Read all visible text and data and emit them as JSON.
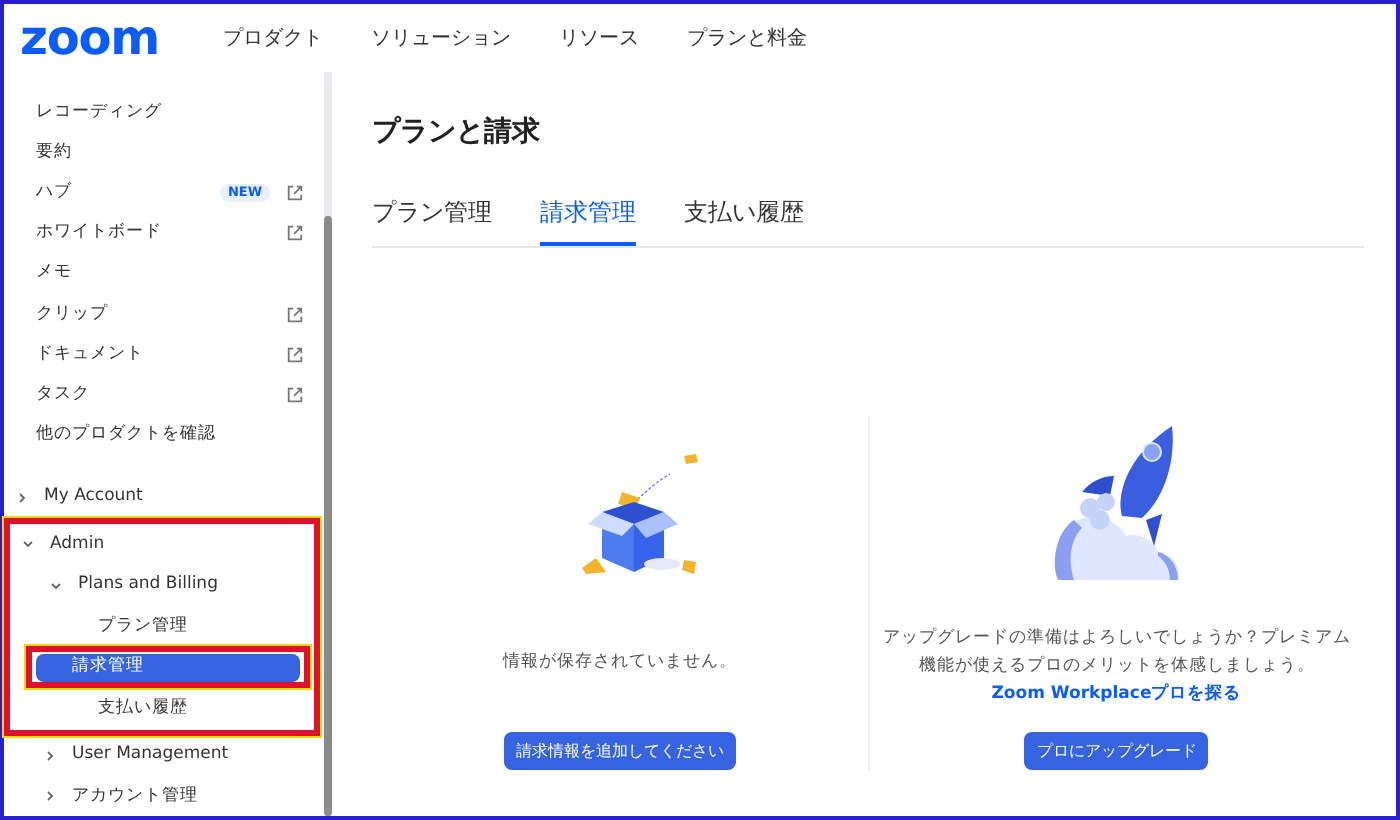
{
  "header": {
    "logo": "zoom",
    "nav": [
      "プロダクト",
      "ソリューション",
      "リソース",
      "プランと料金"
    ]
  },
  "sidebar": {
    "items": [
      {
        "label": "レコーディング",
        "external": false
      },
      {
        "label": "要約",
        "external": false
      },
      {
        "label": "ハブ",
        "badge": "NEW",
        "external": true
      },
      {
        "label": "ホワイトボード",
        "external": true
      },
      {
        "label": "メモ",
        "external": false
      },
      {
        "label": "クリップ",
        "external": true
      },
      {
        "label": "ドキュメント",
        "external": true
      },
      {
        "label": "タスク",
        "external": true
      },
      {
        "label": "他のプロダクトを確認",
        "external": false
      }
    ],
    "tree": [
      {
        "label": "My Account",
        "expanded": false,
        "highlighted": false
      },
      {
        "label": "Admin",
        "expanded": true,
        "highlighted": true,
        "children": [
          {
            "label": "Plans and Billing",
            "expanded": true,
            "children": [
              {
                "label": "プラン管理",
                "selected": false
              },
              {
                "label": "請求管理",
                "selected": true
              },
              {
                "label": "支払い履歴",
                "selected": false
              }
            ]
          },
          {
            "label": "User Management",
            "expanded": false
          },
          {
            "label": "アカウント管理",
            "expanded": false
          }
        ]
      }
    ]
  },
  "page": {
    "title": "プランと請求",
    "tabs": [
      {
        "label": "プラン管理",
        "selected": false
      },
      {
        "label": "請求管理",
        "selected": true
      },
      {
        "label": "支払い履歴",
        "selected": false
      }
    ],
    "panels": [
      {
        "kind": "box",
        "message": "情報が保存されていません。",
        "button": "請求情報を追加してください"
      },
      {
        "kind": "rocket",
        "message": "アップグレードの準備はよろしいでしょうか？プレミアム機能が使えるプロのメリットを体感しましょう。",
        "link": "Zoom Workplaceプロを探る",
        "button": "プロにアップグレード"
      }
    ]
  }
}
